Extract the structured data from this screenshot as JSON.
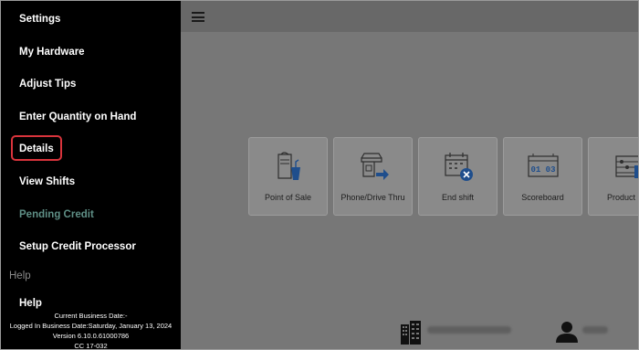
{
  "sidebar": {
    "items": [
      {
        "label": "Settings"
      },
      {
        "label": "My Hardware"
      },
      {
        "label": "Adjust Tips"
      },
      {
        "label": "Enter Quantity on Hand"
      },
      {
        "label": "Details"
      },
      {
        "label": "View Shifts"
      },
      {
        "label": "Pending Credit"
      },
      {
        "label": "Setup Credit Processor"
      }
    ],
    "help_section": "Help",
    "help_item": "Help",
    "footer": {
      "current_business_date": "Current Business Date:-",
      "logged_in_business_date": "Logged In Business Date:Saturday, January 13, 2024",
      "version": "Version 6.10.0.61000786",
      "code": "CC 17-032"
    }
  },
  "main": {
    "tiles": [
      {
        "label": "Point of Sale",
        "icon": "point-of-sale-icon"
      },
      {
        "label": "Phone/Drive Thru",
        "icon": "phone-drive-thru-icon"
      },
      {
        "label": "End shift",
        "icon": "end-shift-icon"
      },
      {
        "label": "Scoreboard",
        "icon": "scoreboard-icon"
      },
      {
        "label": "Product Co",
        "icon": "product-count-icon"
      }
    ],
    "scoreboard_digits": "01 03"
  },
  "colors": {
    "sidebar_bg": "#000000",
    "highlight": "#d9343c",
    "pending_text": "#5f8f86",
    "icon_blue": "#1f4e8c"
  }
}
